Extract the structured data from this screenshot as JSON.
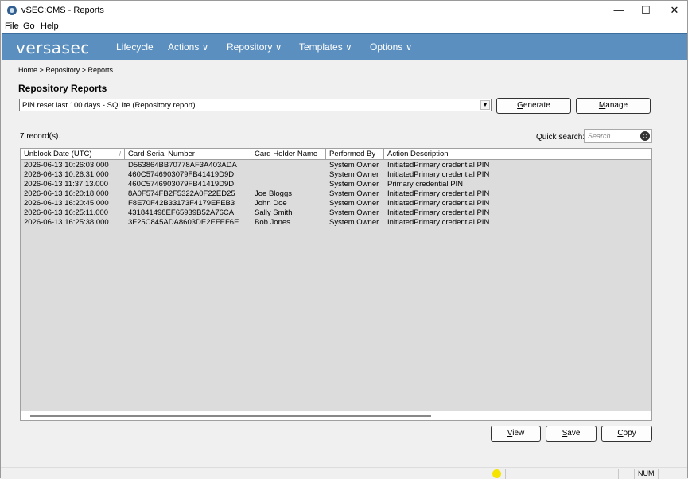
{
  "window": {
    "title": "vSEC:CMS -  Reports",
    "minimize": "—",
    "maximize": "☐",
    "close": "✕"
  },
  "menubar": {
    "items": [
      "File",
      "Go",
      "Help"
    ]
  },
  "nav": {
    "logo": "versasec",
    "items": [
      "Lifecycle",
      "Actions  ∨",
      "Repository  ∨",
      "Templates  ∨",
      "Options  ∨"
    ]
  },
  "breadcrumb": "Home > Repository > Reports",
  "page_title": "Repository Reports",
  "report_select": {
    "value": "PIN reset last 100 days - SQLite (Repository report)"
  },
  "buttons": {
    "generate_ul": "G",
    "generate_rest": "enerate",
    "manage_ul": "M",
    "manage_rest": "anage",
    "view_ul": "V",
    "view_rest": "iew",
    "save_ul": "S",
    "save_rest": "ave",
    "copy_ul": "C",
    "copy_rest": "opy"
  },
  "records_count": "7 record(s).",
  "quick_search": {
    "label": "Quick search:",
    "placeholder": "Search"
  },
  "table": {
    "columns": [
      "Unblock Date (UTC)",
      "Card Serial Number",
      "Card Holder Name",
      "Performed By",
      "Action Description"
    ],
    "sort_indicator": "/",
    "rows": [
      [
        "2026-06-13 10:26:03.000",
        "D563864BB70778AF3A403ADA",
        "",
        "System Owner",
        "InitiatedPrimary credential PIN"
      ],
      [
        "2026-06-13 10:26:31.000",
        "460C5746903079FB41419D9D",
        "",
        "System Owner",
        "InitiatedPrimary credential PIN"
      ],
      [
        "2026-06-13 11:37:13.000",
        "460C5746903079FB41419D9D",
        "",
        "System Owner",
        "Primary credential PIN"
      ],
      [
        "2026-06-13 16:20:18.000",
        "8A0F574FB2F5322A0F22ED25",
        "Joe Bloggs",
        "System Owner",
        "InitiatedPrimary credential PIN"
      ],
      [
        "2026-06-13 16:20:45.000",
        "F8E70F42B33173F4179EFEB3",
        "John Doe",
        "System Owner",
        "InitiatedPrimary credential PIN"
      ],
      [
        "2026-06-13 16:25:11.000",
        "431841498EF65939B52A76CA",
        "Sally Smith",
        "System Owner",
        "InitiatedPrimary credential PIN"
      ],
      [
        "2026-06-13 16:25:38.000",
        "3F25C845ADA8603DE2EFEF6E",
        "Bob Jones",
        "System Owner",
        "InitiatedPrimary credential PIN"
      ]
    ]
  },
  "statusbar": {
    "num": "NUM"
  }
}
